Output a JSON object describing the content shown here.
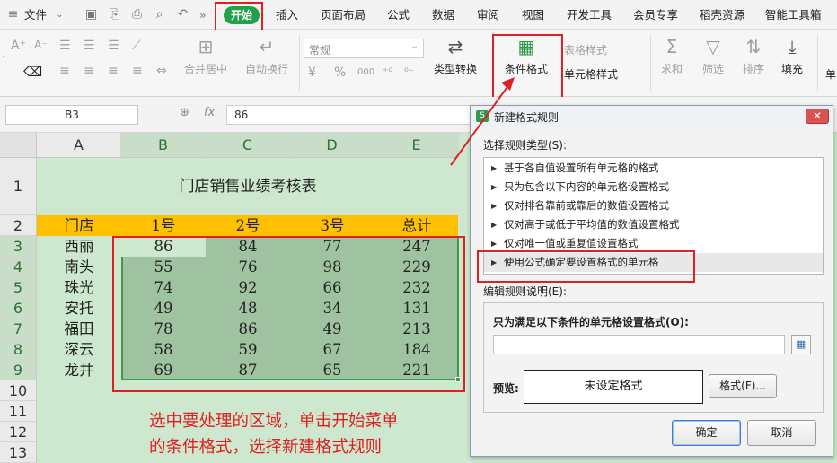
{
  "menubar": {
    "file_label": "文件",
    "more_label": "»",
    "tabs": [
      "开始",
      "插入",
      "页面布局",
      "公式",
      "数据",
      "审阅",
      "视图",
      "开发工具",
      "会员专享",
      "稻壳资源",
      "智能工具箱"
    ]
  },
  "toolbar": {
    "font_up": "A⁺",
    "font_down": "A⁻",
    "merge_center": "合并居中",
    "wrap_text": "自动换行",
    "number_format": "常规",
    "currency_symbol": "¥",
    "percent_symbol": "%",
    "thousands": "000",
    "type_convert": "类型转换",
    "cond_format": "条件格式",
    "table_style": "表格样式",
    "cell_style": "单元格样式",
    "sum": "求和",
    "filter": "筛选",
    "sort": "排序",
    "fill": "填充",
    "cut_label": "单"
  },
  "formula_bar": {
    "cell_ref": "B3",
    "fx": "fx",
    "value": "86"
  },
  "sheet": {
    "columns": [
      "A",
      "B",
      "C",
      "D",
      "E"
    ],
    "rows": [
      "1",
      "2",
      "3",
      "4",
      "5",
      "6",
      "7",
      "8",
      "9",
      "10",
      "11",
      "12",
      "13"
    ],
    "title": "门店销售业绩考核表",
    "header": [
      "门店",
      "1号",
      "2号",
      "3号",
      "总计"
    ],
    "data": [
      [
        "西丽",
        "86",
        "84",
        "77",
        "247"
      ],
      [
        "南头",
        "55",
        "76",
        "98",
        "229"
      ],
      [
        "珠光",
        "74",
        "92",
        "66",
        "232"
      ],
      [
        "安托",
        "49",
        "48",
        "34",
        "131"
      ],
      [
        "福田",
        "78",
        "86",
        "49",
        "213"
      ],
      [
        "深云",
        "58",
        "59",
        "67",
        "184"
      ],
      [
        "龙井",
        "69",
        "87",
        "65",
        "221"
      ]
    ],
    "hint_line1": "选中要处理的区域，单击开始菜单",
    "hint_line2": "的条件格式，选择新建格式规则"
  },
  "dialog": {
    "title": "新建格式规则",
    "select_rule_type_label": "选择规则类型(S):",
    "rules": [
      "基于各自值设置所有单元格的格式",
      "只为包含以下内容的单元格设置格式",
      "仅对排名靠前或靠后的数值设置格式",
      "仅对高于或低于平均值的数值设置格式",
      "仅对唯一值或重复值设置格式",
      "使用公式确定要设置格式的单元格"
    ],
    "edit_rule_label": "编辑规则说明(E):",
    "condition_label": "只为满足以下条件的单元格设置格式(O):",
    "condition_value": "",
    "preview_label": "预览:",
    "preview_text": "未设定格式",
    "format_button": "格式(F)...",
    "ok_button": "确定",
    "cancel_button": "取消"
  },
  "colors": {
    "accent_green": "#22a04b",
    "highlight_red": "#e12121",
    "header_fill": "#ffc000",
    "sheet_fill": "#cde8cf",
    "selection_fill": "#9fc2a0"
  }
}
